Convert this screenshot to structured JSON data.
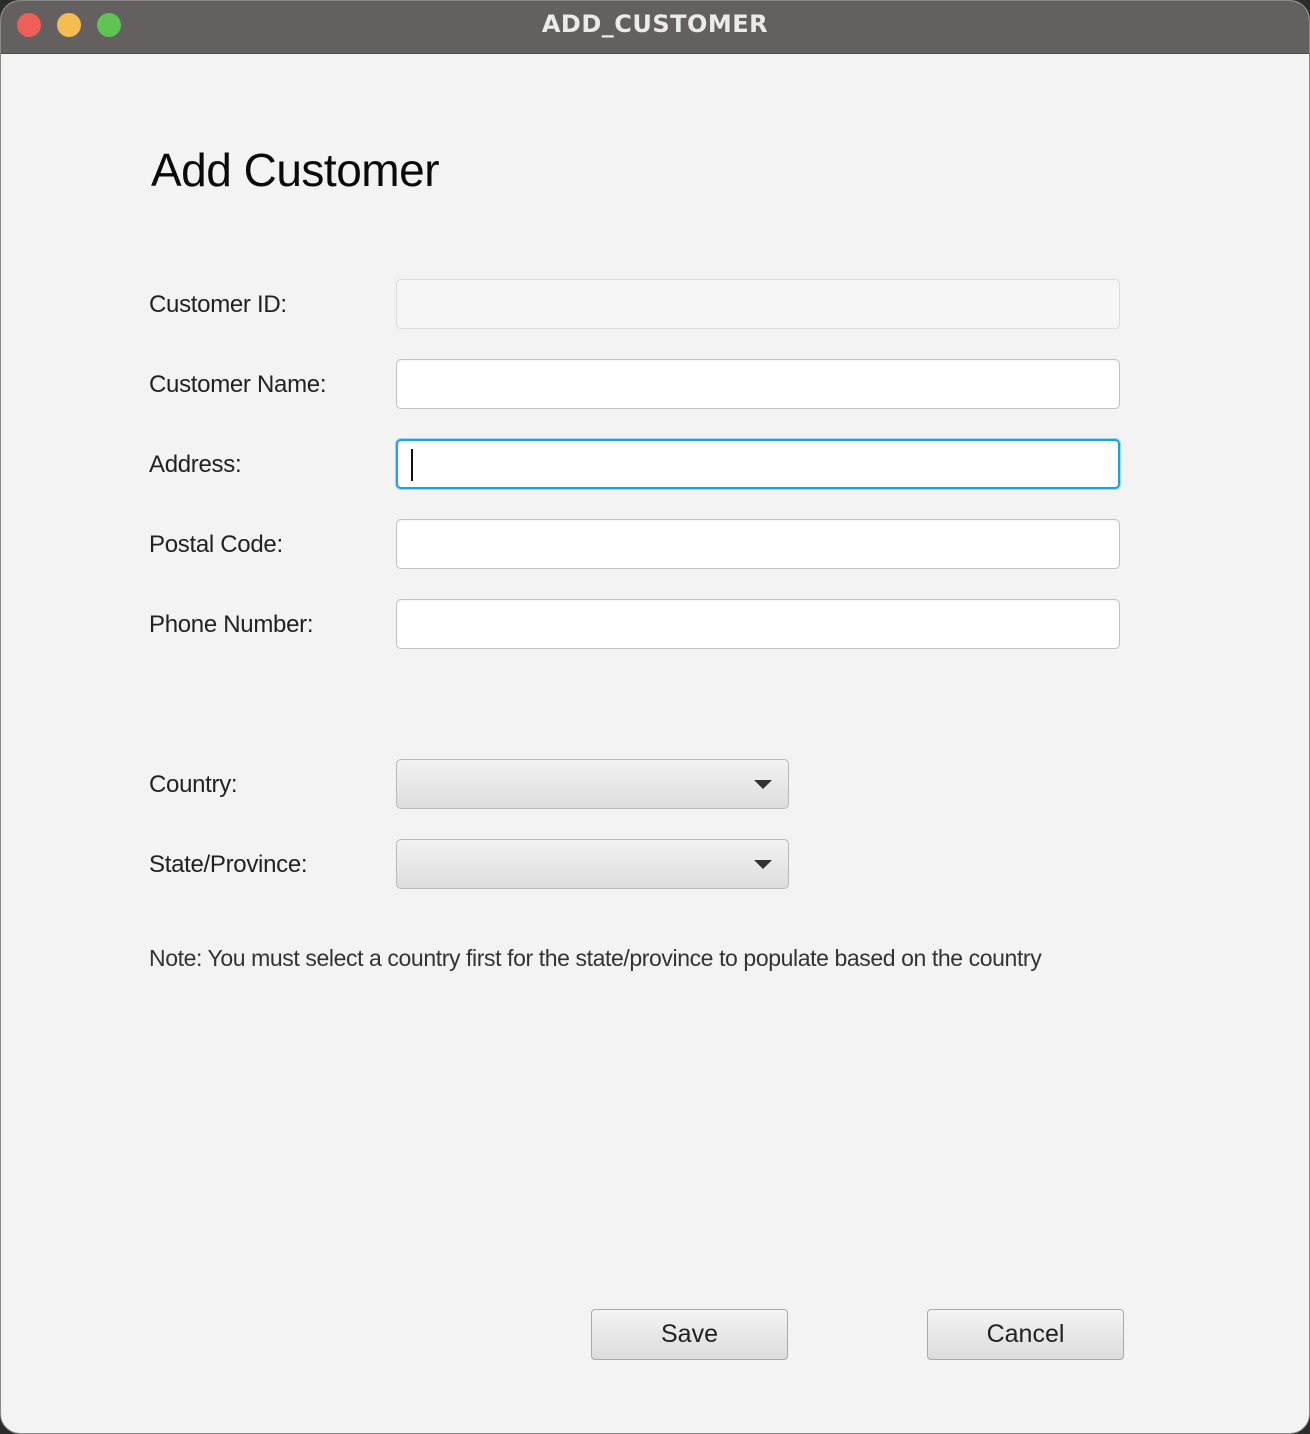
{
  "window": {
    "title": "ADD_CUSTOMER"
  },
  "form": {
    "heading": "Add Customer",
    "fields": [
      {
        "label": "Customer ID:",
        "value": "",
        "disabled": true
      },
      {
        "label": "Customer Name:",
        "value": ""
      },
      {
        "label": "Address:",
        "value": "",
        "focused": true
      },
      {
        "label": "Postal Code:",
        "value": ""
      },
      {
        "label": "Phone Number:",
        "value": ""
      }
    ],
    "selects": [
      {
        "label": "Country:",
        "selected": ""
      },
      {
        "label": "State/Province:",
        "selected": ""
      }
    ],
    "note": "Note: You must select a country first for the state/province to populate based on the country"
  },
  "buttons": {
    "save_label": "Save",
    "cancel_label": "Cancel"
  },
  "colors": {
    "titlebar": "#656060",
    "background": "#f3f3f3",
    "focus_ring": "#1ca3d8",
    "close": "#ee5f57",
    "minimize": "#f5bd4f",
    "zoom": "#5fc454"
  }
}
